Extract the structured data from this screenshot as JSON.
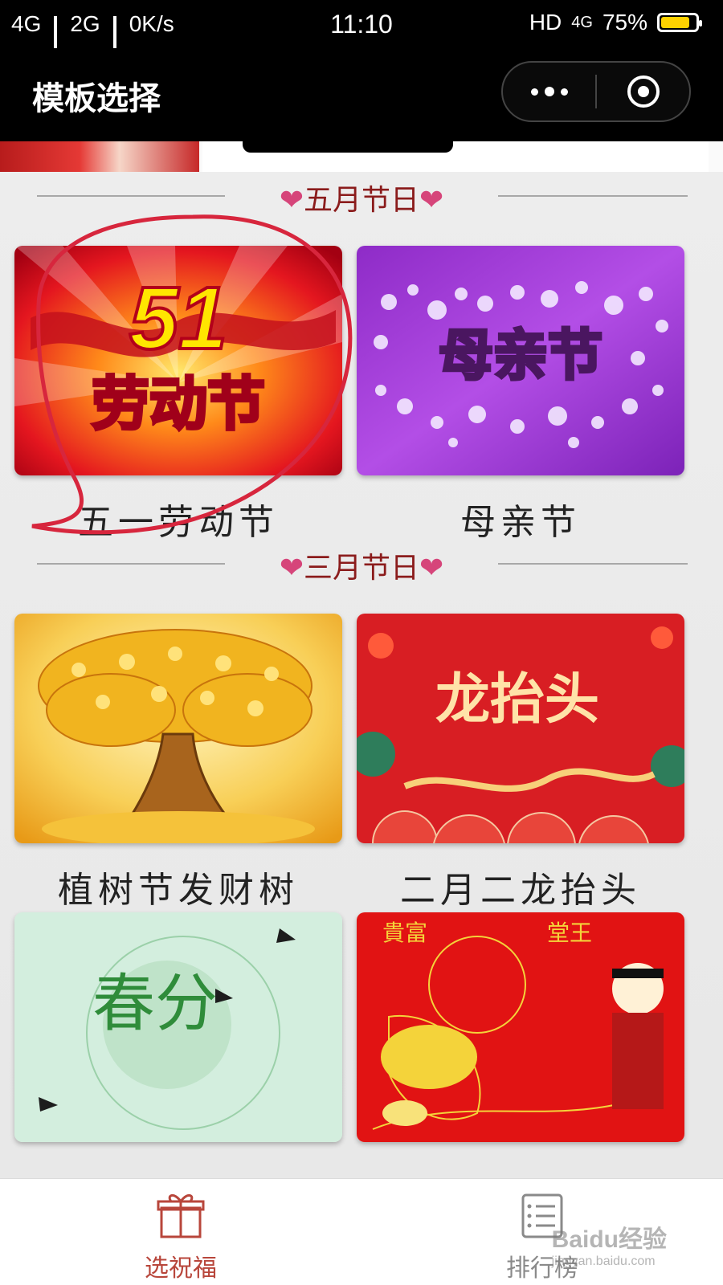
{
  "status_bar": {
    "network1": "4G",
    "network2": "2G",
    "speed": "0K/s",
    "time": "11:10",
    "hd": "HD",
    "network3": "4G",
    "battery": "75%",
    "battery_level": 0.75,
    "battery_color": "#ffd200"
  },
  "nav": {
    "title": "模板选择",
    "more_icon": "more-dots-icon",
    "close_icon": "target-circle-icon"
  },
  "sections": [
    {
      "title": "五月节日",
      "cards": [
        {
          "title": "五一劳动节",
          "thumb_text_top": "51",
          "thumb_text_bottom": "劳动节"
        },
        {
          "title": "母亲节",
          "thumb_text": "母亲节"
        }
      ]
    },
    {
      "title": "三月节日",
      "cards": [
        {
          "title": "植树节发财树"
        },
        {
          "title": "二月二龙抬头",
          "thumb_text": "龙抬头"
        },
        {
          "title": "",
          "thumb_text": "春分"
        },
        {
          "title": "",
          "thumb_text_left": "貴富",
          "thumb_text_right": "堂王"
        }
      ]
    }
  ],
  "tabs": [
    {
      "label": "选祝福",
      "icon": "gift-icon",
      "active": true
    },
    {
      "label": "排行榜",
      "icon": "ranking-list-icon",
      "active": false
    }
  ],
  "watermark": {
    "text": "Baidu经验",
    "url": "jingyan.baidu.com"
  },
  "colors": {
    "accent": "#b8463b",
    "heart": "#d6457a",
    "section_title": "#8b1c1c",
    "annotation": "#d7263d"
  }
}
